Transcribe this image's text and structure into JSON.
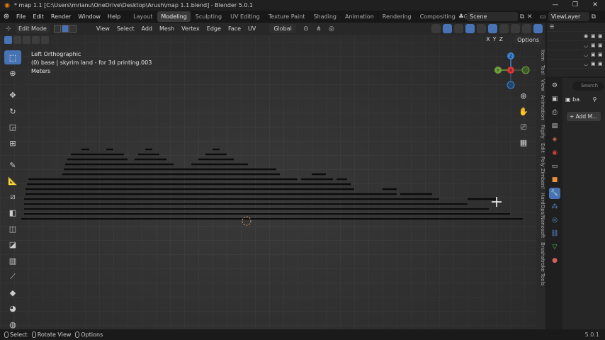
{
  "window": {
    "title": "* map 1.1 [C:\\Users\\mrianu\\OneDrive\\Desktop\\Arush\\map 1.1.blend] - Blender 5.0.1",
    "controls": [
      "—",
      "❐",
      "✕"
    ]
  },
  "menus": [
    "File",
    "Edit",
    "Render",
    "Window",
    "Help"
  ],
  "workspaces": [
    {
      "label": "Layout",
      "active": false
    },
    {
      "label": "Modeling",
      "active": true
    },
    {
      "label": "Sculpting",
      "active": false
    },
    {
      "label": "UV Editing",
      "active": false
    },
    {
      "label": "Texture Paint",
      "active": false
    },
    {
      "label": "Shading",
      "active": false
    },
    {
      "label": "Animation",
      "active": false
    },
    {
      "label": "Rendering",
      "active": false
    },
    {
      "label": "Compositing",
      "active": false
    },
    {
      "label": "Geometr",
      "active": false
    }
  ],
  "scene": {
    "label": "Scene"
  },
  "view_layer": {
    "label": "ViewLayer"
  },
  "viewport_header": {
    "mode": "Edit Mode",
    "menus": [
      "View",
      "Select",
      "Add",
      "Mesh",
      "Vertex",
      "Edge",
      "Face",
      "UV"
    ],
    "transform_orientation": "Global"
  },
  "viewport_sub_header": {
    "axes": [
      "X",
      "Y",
      "Z"
    ],
    "options_label": "Options"
  },
  "viewport_info": {
    "view_name": "Left Orthographic",
    "object_line": "(0) base | skyrim land - for 3d printing.003",
    "units": "Meters"
  },
  "gizmo": {
    "z": "Z",
    "y": "Y",
    "x": "X"
  },
  "npanel_tabs": [
    "Item",
    "Tool",
    "View",
    "Animation",
    "Rigify",
    "Edit",
    "Poly Zimbanl",
    "HardOps/Nanosoft",
    "Brushstroke Tools"
  ],
  "properties": {
    "search_placeholder": "Search",
    "object_name": "ba",
    "add_modifier_label": "Add M..."
  },
  "status_bar": {
    "hints": [
      "Select",
      "Rotate View",
      "Options"
    ],
    "version": "5.0.1"
  },
  "colors": {
    "accent": "#4772b3",
    "axis_x": "#e0353b",
    "axis_y": "#6fa43a",
    "axis_z": "#3c83cf",
    "blender_orange": "#e87d0d"
  }
}
